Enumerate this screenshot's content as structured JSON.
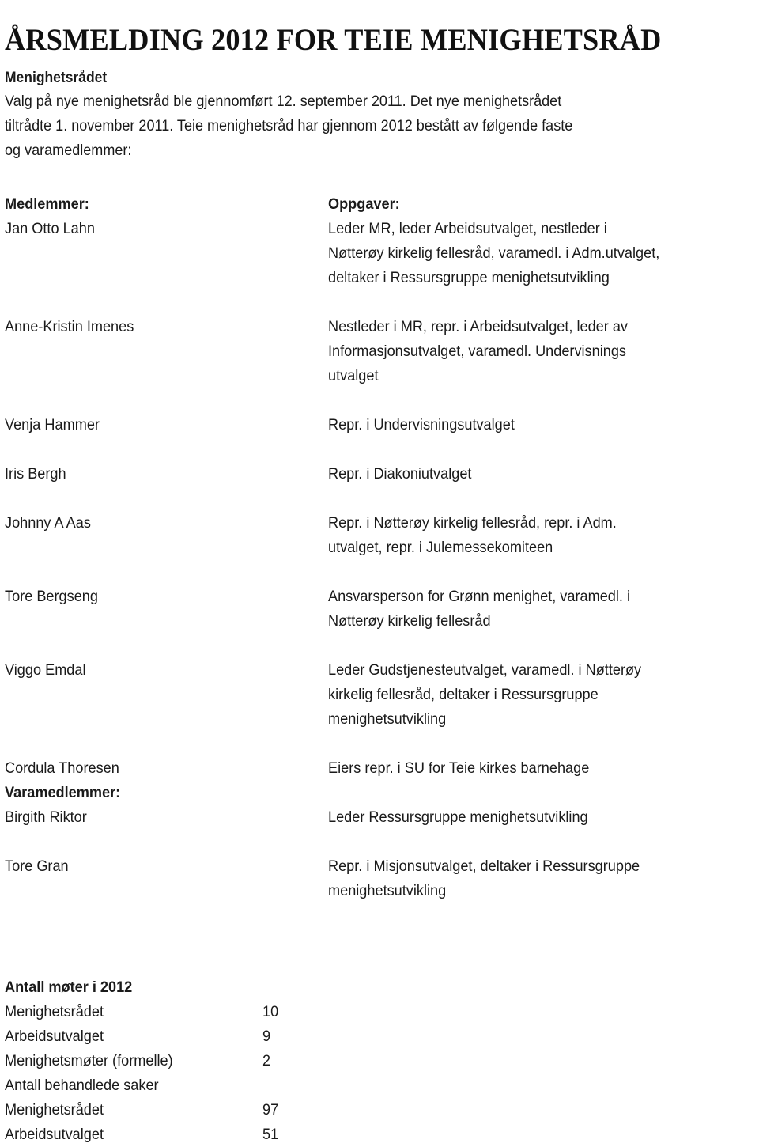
{
  "document": {
    "title": "ÅRSMELDING 2012 FOR TEIE MENIGHETSRÅD"
  },
  "intro": {
    "heading": "Menighetsrådet",
    "line1": "Valg på nye menighetsråd ble gjennomført 12. september 2011. Det nye menighetsrådet",
    "line2": "tiltrådte 1. november 2011. Teie menighetsråd har gjennom 2012 bestått av følgende faste",
    "line3": "og varamedlemmer:"
  },
  "members_table": {
    "header_name": "Medlemmer:",
    "header_task": "Oppgaver:",
    "varamedlemmer_header": "Varamedlemmer:",
    "rows": [
      {
        "name": "Jan Otto Lahn",
        "task_lines": [
          "Leder MR, leder Arbeidsutvalget, nestleder i",
          "Nøtterøy kirkelig fellesråd, varamedl. i Adm.utvalget,",
          "deltaker i Ressursgruppe menighetsutvikling"
        ]
      },
      {
        "name": "Anne-Kristin Imenes",
        "task_lines": [
          "Nestleder i MR, repr. i Arbeidsutvalget, leder av",
          "Informasjonsutvalget, varamedl. Undervisnings",
          "utvalget"
        ]
      },
      {
        "name": "Venja Hammer",
        "task_lines": [
          "Repr. i Undervisningsutvalget"
        ]
      },
      {
        "name": "Iris Bergh",
        "task_lines": [
          "Repr. i Diakoniutvalget"
        ]
      },
      {
        "name": "Johnny A Aas",
        "task_lines": [
          "Repr. i Nøtterøy kirkelig fellesråd, repr. i Adm.",
          "utvalget, repr. i Julemessekomiteen"
        ]
      },
      {
        "name": "Tore Bergseng",
        "task_lines": [
          "Ansvarsperson for Grønn menighet, varamedl. i",
          "Nøtterøy kirkelig fellesråd"
        ]
      },
      {
        "name": "Viggo Emdal",
        "task_lines": [
          "Leder Gudstjenesteutvalget, varamedl. i Nøtterøy",
          "kirkelig fellesråd, deltaker i Ressursgruppe",
          "menighetsutvikling"
        ]
      },
      {
        "name": "Cordula Thoresen",
        "task_lines": [
          "Eiers repr. i SU for Teie kirkes barnehage"
        ]
      },
      {
        "name": "Birgith Riktor",
        "task_lines": [
          "Leder Ressursgruppe menighetsutvikling"
        ]
      },
      {
        "name": "Tore Gran",
        "task_lines": [
          "Repr. i Misjonsutvalget, deltaker i Ressursgruppe",
          "menighetsutvikling"
        ]
      }
    ]
  },
  "summary": {
    "title": "Antall møter i 2012",
    "rows": [
      {
        "label": "Menighetsrådet",
        "value": "10"
      },
      {
        "label": "Arbeidsutvalget",
        "value": "9"
      },
      {
        "label": "Menighetsmøter (formelle)",
        "value": "2"
      },
      {
        "label": "Antall behandlede saker",
        "value": ""
      },
      {
        "label": "Menighetsrådet",
        "value": "97"
      },
      {
        "label": "Arbeidsutvalget",
        "value": "51"
      }
    ]
  }
}
